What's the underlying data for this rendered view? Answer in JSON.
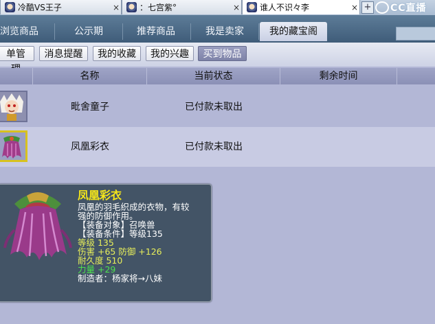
{
  "browser": {
    "tabs": [
      {
        "title": "冷酷VS王子",
        "close": "×"
      },
      {
        "title": "：七宫紫°",
        "close": "×"
      },
      {
        "title": "谁人不识々李",
        "close": "×"
      }
    ],
    "new_tab": "+",
    "logo_text": "CC直播"
  },
  "nav": {
    "tabs": [
      "浏览商品",
      "公示期",
      "推荐商品",
      "我是卖家",
      "我的藏宝阁"
    ],
    "active_index": 4
  },
  "subnav": {
    "buttons": [
      "单管理",
      "消息提醒",
      "我的收藏",
      "我的兴趣",
      "买到物品"
    ],
    "active_index": 4
  },
  "table": {
    "columns": [
      "名称",
      "当前状态",
      "剩余时间"
    ],
    "rows": [
      {
        "name": "毗舍童子",
        "status": "已付款未取出",
        "time": ""
      },
      {
        "name": "凤凰彩衣",
        "status": "已付款未取出",
        "time": ""
      }
    ]
  },
  "tooltip": {
    "name": "凤凰彩衣",
    "desc_line1": "凤凰的羽毛织成的衣物，有较",
    "desc_line2": "强的防御作用。",
    "target": "【装备对象】召唤兽",
    "requirement": "【装备条件】等级135",
    "level": "等级 135",
    "attack_defense": "伤害 +65 防御 +126",
    "durability": "耐久度 510",
    "strength": "力量 +29",
    "maker": "制造者：杨家将→八妹"
  },
  "colors": {
    "nav_bg": "#4a6886",
    "active_sub": "#8a8eb2",
    "tooltip_bg": "#435466",
    "tooltip_name": "#f5e61a",
    "stat_yellow": "#e8ef5a",
    "stat_green": "#4ee24e"
  }
}
